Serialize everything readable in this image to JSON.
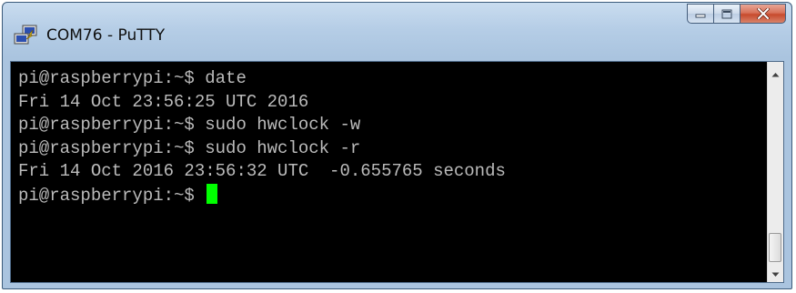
{
  "window": {
    "title": "COM76 - PuTTY",
    "icon": "putty-icon",
    "controls": {
      "minimize_icon": "minimize-icon",
      "maximize_icon": "maximize-icon",
      "close_icon": "close-icon"
    }
  },
  "colors": {
    "terminal_background": "#000000",
    "terminal_text": "#bbbbbb",
    "cursor": "#00ff00",
    "close_button": "#c74a2d"
  },
  "terminal": {
    "lines": [
      "pi@raspberrypi:~$ date",
      "Fri 14 Oct 23:56:25 UTC 2016",
      "pi@raspberrypi:~$ sudo hwclock -w",
      "pi@raspberrypi:~$ sudo hwclock -r",
      "Fri 14 Oct 2016 23:56:32 UTC  -0.655765 seconds",
      "pi@raspberrypi:~$ "
    ],
    "cursor_visible": true
  },
  "scrollbar": {
    "up_icon": "scroll-up-arrow-icon",
    "down_icon": "scroll-down-arrow-icon",
    "position_fraction": 1.0
  }
}
